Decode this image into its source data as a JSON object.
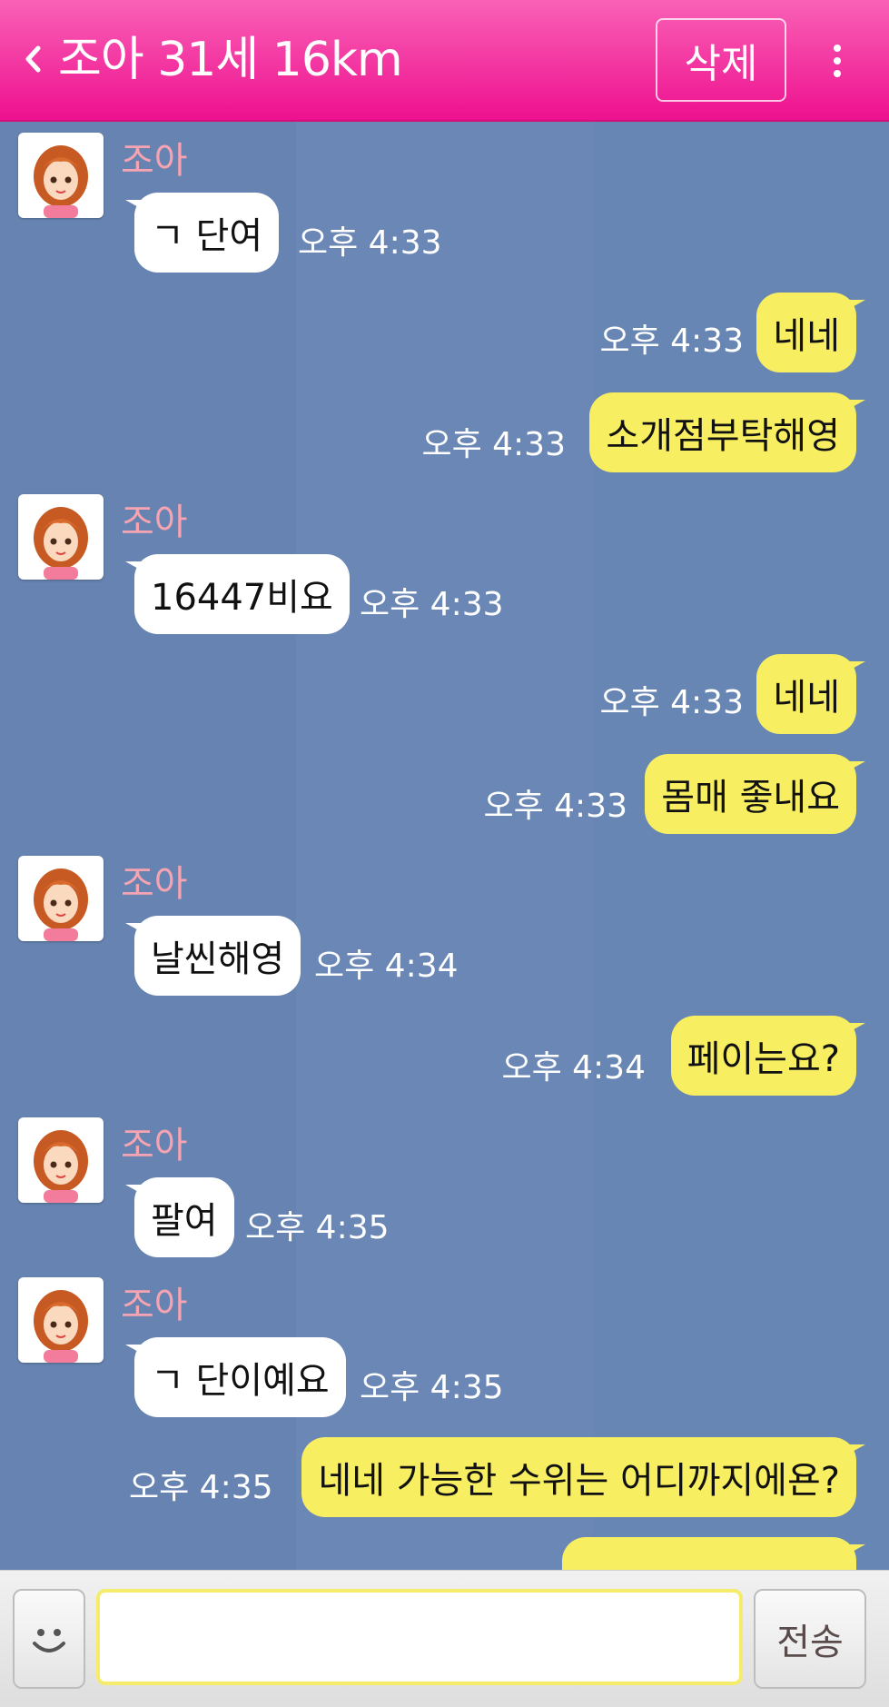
{
  "header": {
    "title": "조아 31세 16km",
    "delete_label": "삭제"
  },
  "sender_name": "조아",
  "messages": [
    {
      "text": "ㄱ 단여",
      "time": "오후 4:33"
    },
    {
      "text": "네네",
      "time": "오후 4:33"
    },
    {
      "text": "소개점부탁해영",
      "time": "오후 4:33"
    },
    {
      "text": "16447비요",
      "time": "오후 4:33"
    },
    {
      "text": "네네",
      "time": "오후 4:33"
    },
    {
      "text": "몸매 좋내요",
      "time": "오후 4:33"
    },
    {
      "text": "날씬해영",
      "time": "오후 4:34"
    },
    {
      "text": "페이는요?",
      "time": "오후 4:34"
    },
    {
      "text": "팔여",
      "time": "오후 4:35"
    },
    {
      "text": "ㄱ 단이예요",
      "time": "오후 4:35"
    },
    {
      "text": "네네 가능한 수위는 어디까지에욘?",
      "time": "오후 4:35"
    }
  ],
  "input": {
    "value": "",
    "placeholder": ""
  },
  "send_label": "전송",
  "icons": {
    "back": "chevron-left-icon",
    "more": "more-vertical-icon",
    "emoji": "smiley-icon",
    "avatar": "profile-avatar"
  },
  "colors": {
    "header": "#ee118f",
    "chat_bg": "#6a87b5",
    "my_bubble": "#f8ee62",
    "their_bubble": "#ffffff",
    "sender_name": "#f6a3b2"
  }
}
